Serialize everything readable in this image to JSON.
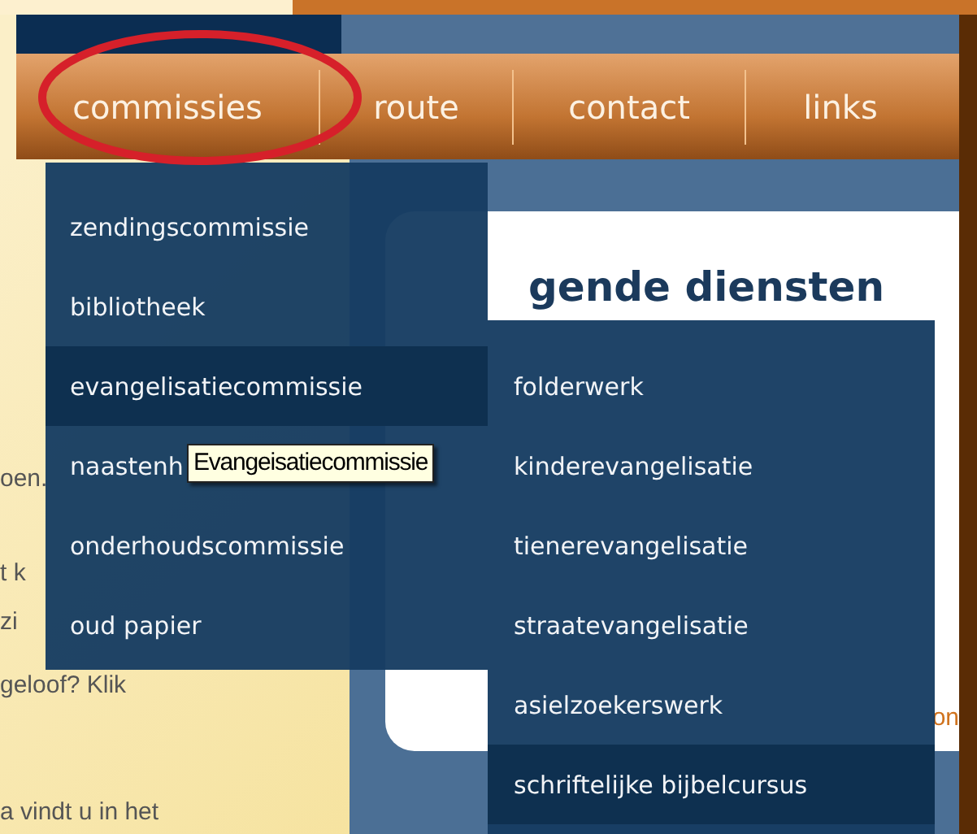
{
  "nav": {
    "items": [
      {
        "label": "commissies"
      },
      {
        "label": "route"
      },
      {
        "label": "contact"
      },
      {
        "label": "links"
      }
    ]
  },
  "sidebar": {
    "lines": [
      "oen.",
      "t k",
      "zi",
      "geloof? Klik",
      "a vindt u in het"
    ]
  },
  "content": {
    "heading": "gende diensten",
    "more_link": "on"
  },
  "dropdown": {
    "items": [
      {
        "label": "zendingscommissie",
        "selected": false
      },
      {
        "label": "bibliotheek",
        "selected": false
      },
      {
        "label": "evangelisatiecommissie",
        "selected": true
      },
      {
        "label": "naastenh",
        "selected": false
      },
      {
        "label": "onderhoudscommissie",
        "selected": false
      },
      {
        "label": "oud papier",
        "selected": false
      }
    ]
  },
  "submenu": {
    "items": [
      {
        "label": "folderwerk",
        "selected": false
      },
      {
        "label": "kinderevangelisatie",
        "selected": false
      },
      {
        "label": "tienerevangelisatie",
        "selected": false
      },
      {
        "label": "straatevangelisatie",
        "selected": false
      },
      {
        "label": "asielzoekerswerk",
        "selected": false
      },
      {
        "label": "schriftelijke bijbelcursus",
        "selected": true
      }
    ]
  },
  "tooltip": {
    "text": "Evangeisatiecommissie"
  }
}
